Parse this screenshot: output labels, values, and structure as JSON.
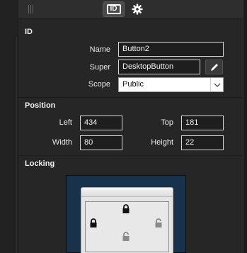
{
  "toolbar": {
    "id_label": "ID"
  },
  "sections": {
    "id": {
      "title": "ID",
      "name_label": "Name",
      "name_value": "Button2",
      "super_label": "Super",
      "super_value": "DesktopButton",
      "scope_label": "Scope",
      "scope_value": "Public"
    },
    "position": {
      "title": "Position",
      "left_label": "Left",
      "left_value": "434",
      "top_label": "Top",
      "top_value": "181",
      "width_label": "Width",
      "width_value": "80",
      "height_label": "Height",
      "height_value": "22"
    },
    "locking": {
      "title": "Locking",
      "locks": {
        "top": "locked",
        "left": "locked",
        "right": "unlocked",
        "bottom": "unlocked"
      }
    }
  },
  "icons": {
    "id_tab": "id-card-icon",
    "settings_tab": "gear-icon",
    "edit_super": "pencil-icon",
    "scope_dropdown": "chevron-down-icon"
  },
  "colors": {
    "background": "#262626",
    "lock_preview_bg": "#17324a",
    "field_border": "#d8d8d8"
  }
}
